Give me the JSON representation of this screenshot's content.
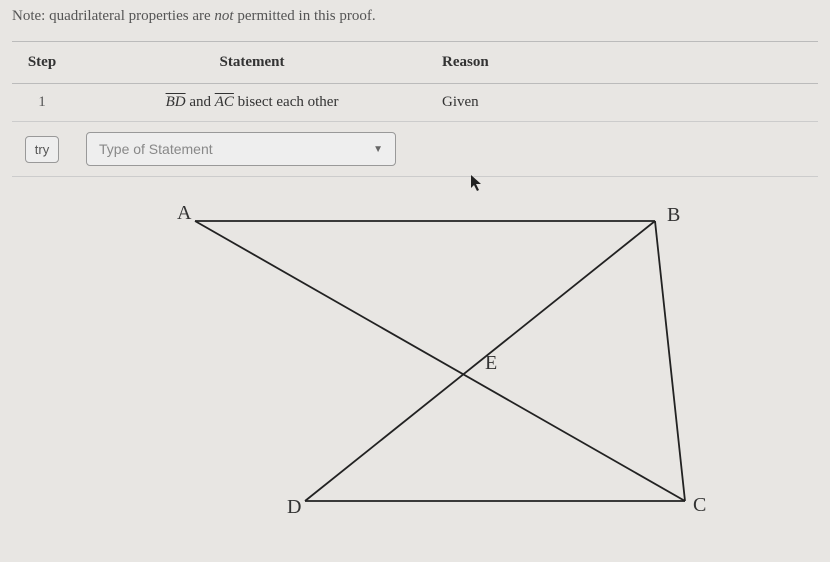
{
  "note": {
    "prefix": "Note: quadrilateral properties are ",
    "emph": "not",
    "suffix": " permitted in this proof."
  },
  "table": {
    "headers": {
      "step": "Step",
      "statement": "Statement",
      "reason": "Reason"
    },
    "row1": {
      "step": "1",
      "seg1": "BD",
      "mid": " and ",
      "seg2": "AC",
      "tail": " bisect each other",
      "reason": "Given"
    },
    "row2": {
      "try": "try",
      "placeholder": "Type of Statement"
    }
  },
  "diagram": {
    "points": {
      "A": "A",
      "B": "B",
      "C": "C",
      "D": "D",
      "E": "E"
    }
  }
}
